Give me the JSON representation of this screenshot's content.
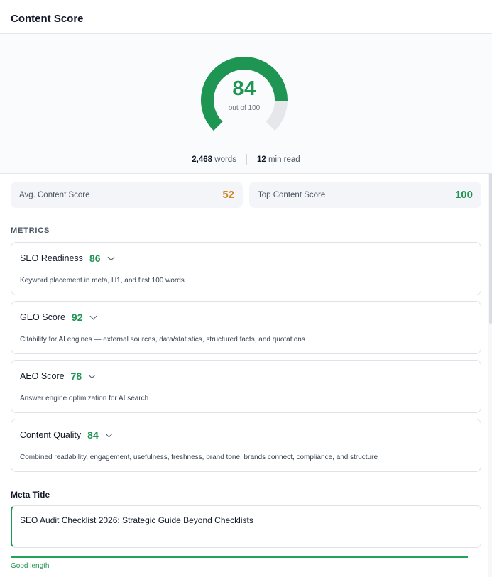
{
  "header": {
    "title": "Content Score"
  },
  "score": {
    "value": "84",
    "out_of": "out of 100",
    "fraction": 0.84,
    "color": "#1e9552",
    "track_color": "#e5e7eb"
  },
  "stats": {
    "words_value": "2,468",
    "words_label": "words",
    "read_value": "12",
    "read_label": "min read"
  },
  "summary": {
    "avg_label": "Avg. Content Score",
    "avg_value": "52",
    "top_label": "Top Content Score",
    "top_value": "100"
  },
  "metrics": {
    "section_label": "METRICS",
    "items": [
      {
        "name": "SEO Readiness",
        "score": "86",
        "desc": "Keyword placement in meta, H1, and first 100 words"
      },
      {
        "name": "GEO Score",
        "score": "92",
        "desc": "Citability for AI engines — external sources, data/statistics, structured facts, and quotations"
      },
      {
        "name": "AEO Score",
        "score": "78",
        "desc": "Answer engine optimization for AI search"
      },
      {
        "name": "Content Quality",
        "score": "84",
        "desc": "Combined readability, engagement, usefulness, freshness, brand tone, brands connect, compliance, and structure"
      }
    ]
  },
  "meta": {
    "label": "Meta Title",
    "value": "SEO Audit Checklist 2026: Strategic Guide Beyond Checklists",
    "hint": "Good length"
  }
}
